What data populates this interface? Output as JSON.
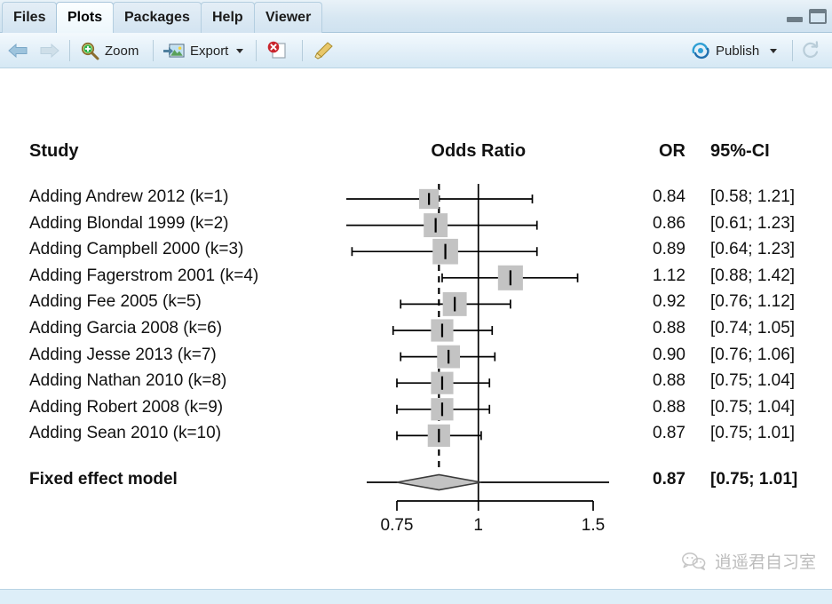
{
  "window": {
    "tabs": [
      {
        "label": "Files",
        "active": false
      },
      {
        "label": "Plots",
        "active": true
      },
      {
        "label": "Packages",
        "active": false
      },
      {
        "label": "Help",
        "active": false
      },
      {
        "label": "Viewer",
        "active": false
      }
    ],
    "minimize_icon": "minimize-icon",
    "maximize_icon": "maximize-icon"
  },
  "toolbar": {
    "back_icon": "back-arrow-icon",
    "forward_icon": "forward-arrow-icon",
    "zoom_label": "Zoom",
    "zoom_icon": "magnifier-icon",
    "export_label": "Export",
    "export_icon": "export-image-icon",
    "export_caret": "chevron-down-icon",
    "remove_icon": "remove-plot-icon",
    "clear_icon": "clear-all-plots-icon",
    "publish_label": "Publish",
    "publish_icon": "publish-icon",
    "publish_caret": "chevron-down-icon",
    "refresh_icon": "refresh-icon"
  },
  "watermark": {
    "icon": "wechat-icon",
    "text": "逍遥君自习室"
  },
  "chart_data": {
    "type": "forest",
    "title": "",
    "headers": {
      "study": "Study",
      "plot": "Odds Ratio",
      "or": "OR",
      "ci": "95%-CI"
    },
    "xlabel": "",
    "xscale": "log",
    "xticks": [
      "0.75",
      "1",
      "1.5"
    ],
    "xtick_values": [
      0.75,
      1,
      1.5
    ],
    "xlim": [
      0.75,
      1.5
    ],
    "null_line": 1,
    "summary_line": 0.87,
    "rows": [
      {
        "label": "Adding Andrew 2012 (k=1)",
        "or": "0.84",
        "ci": "[0.58; 1.21]",
        "est": 0.84,
        "lower": 0.58,
        "upper": 1.21,
        "weight": 0.16
      },
      {
        "label": "Adding Blondal 1999 (k=2)",
        "or": "0.86",
        "ci": "[0.61; 1.23]",
        "est": 0.86,
        "lower": 0.61,
        "upper": 1.23,
        "weight": 0.24
      },
      {
        "label": "Adding Campbell 2000 (k=3)",
        "or": "0.89",
        "ci": "[0.64; 1.23]",
        "est": 0.89,
        "lower": 0.64,
        "upper": 1.23,
        "weight": 0.27
      },
      {
        "label": "Adding Fagerstrom 2001 (k=4)",
        "or": "1.12",
        "ci": "[0.88; 1.42]",
        "est": 1.12,
        "lower": 0.88,
        "upper": 1.42,
        "weight": 0.26
      },
      {
        "label": "Adding Fee 2005 (k=5)",
        "or": "0.92",
        "ci": "[0.76; 1.12]",
        "est": 0.92,
        "lower": 0.76,
        "upper": 1.12,
        "weight": 0.24
      },
      {
        "label": "Adding Garcia 2008 (k=6)",
        "or": "0.88",
        "ci": "[0.74; 1.05]",
        "est": 0.88,
        "lower": 0.74,
        "upper": 1.05,
        "weight": 0.21
      },
      {
        "label": "Adding Jesse 2013 (k=7)",
        "or": "0.90",
        "ci": "[0.76; 1.06]",
        "est": 0.9,
        "lower": 0.76,
        "upper": 1.06,
        "weight": 0.22
      },
      {
        "label": "Adding Nathan 2010 (k=8)",
        "or": "0.88",
        "ci": "[0.75; 1.04]",
        "est": 0.88,
        "lower": 0.75,
        "upper": 1.04,
        "weight": 0.21
      },
      {
        "label": "Adding Robert 2008 (k=9)",
        "or": "0.88",
        "ci": "[0.75; 1.04]",
        "est": 0.88,
        "lower": 0.75,
        "upper": 1.04,
        "weight": 0.21
      },
      {
        "label": "Adding Sean 2010 (k=10)",
        "or": "0.87",
        "ci": "[0.75; 1.01]",
        "est": 0.87,
        "lower": 0.75,
        "upper": 1.01,
        "weight": 0.21
      }
    ],
    "summary": {
      "label": "Fixed effect model",
      "or": "0.87",
      "ci": "[0.75; 1.01]",
      "est": 0.87,
      "lower": 0.75,
      "upper": 1.01
    }
  }
}
